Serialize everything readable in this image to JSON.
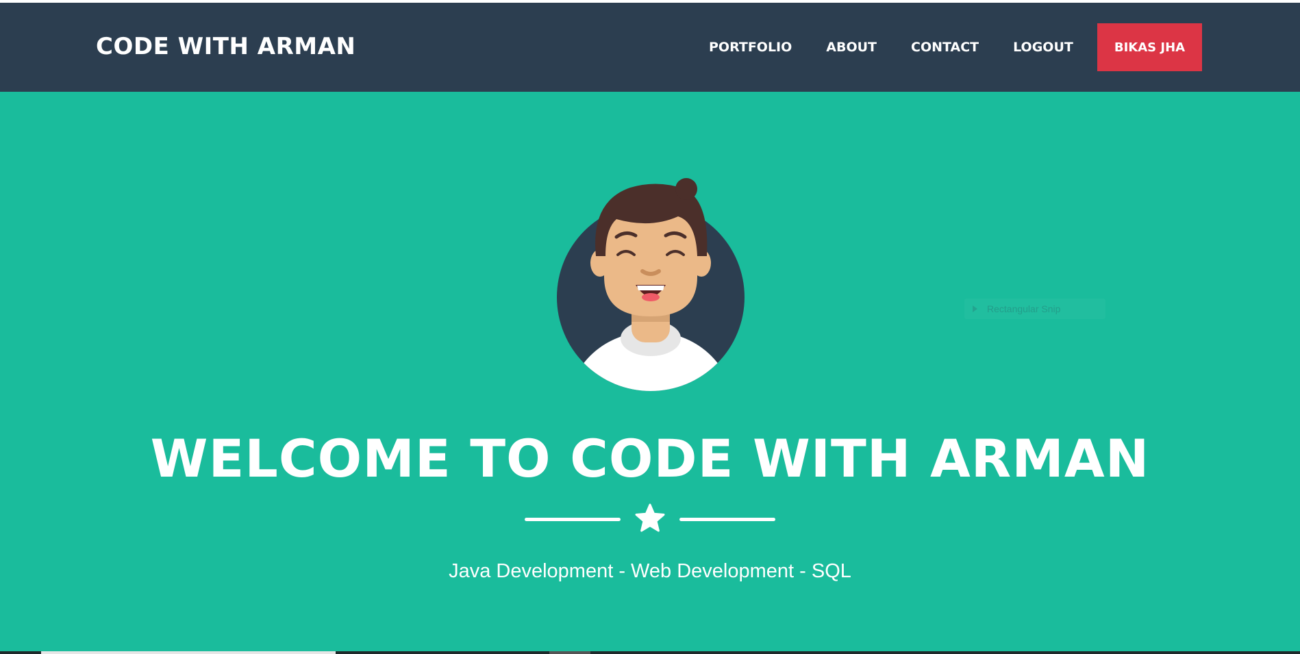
{
  "navbar": {
    "brand": "CODE WITH ARMAN",
    "links": [
      {
        "label": "PORTFOLIO"
      },
      {
        "label": "ABOUT"
      },
      {
        "label": "CONTACT"
      },
      {
        "label": "LOGOUT"
      }
    ],
    "user_button": "BIKAS JHA"
  },
  "hero": {
    "avatar_icon": "smiling-man-avatar-icon",
    "title": "WELCOME TO CODE WITH ARMAN",
    "divider_icon": "star-icon",
    "subtitle": "Java Development - Web Development - SQL"
  },
  "overlay": {
    "tooltip_text": "Rectangular Snip"
  },
  "colors": {
    "navbar_bg": "#2c3e50",
    "hero_bg": "#1abc9c",
    "accent_red": "#dc3545",
    "text": "#ffffff"
  }
}
